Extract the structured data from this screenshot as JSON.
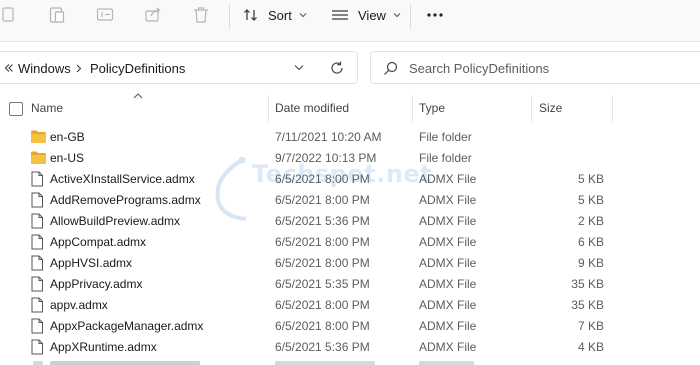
{
  "toolbar": {
    "sort_label": "Sort",
    "view_label": "View",
    "icons": [
      "paste-icon",
      "copy-icon",
      "rename-icon",
      "share-icon",
      "delete-icon",
      "sort-icon",
      "view-icon",
      "more-icon"
    ]
  },
  "address": {
    "breadcrumb": [
      "Windows",
      "PolicyDefinitions"
    ]
  },
  "search": {
    "placeholder": "Search PolicyDefinitions"
  },
  "columns": {
    "name": "Name",
    "date_modified": "Date modified",
    "type": "Type",
    "size": "Size"
  },
  "files": [
    {
      "name": "en-GB",
      "date": "7/11/2021 10:20 AM",
      "type": "File folder",
      "size": "",
      "kind": "folder"
    },
    {
      "name": "en-US",
      "date": "9/7/2022 10:13 PM",
      "type": "File folder",
      "size": "",
      "kind": "folder"
    },
    {
      "name": "ActiveXInstallService.admx",
      "date": "6/5/2021 8:00 PM",
      "type": "ADMX File",
      "size": "5 KB",
      "kind": "file"
    },
    {
      "name": "AddRemovePrograms.admx",
      "date": "6/5/2021 8:00 PM",
      "type": "ADMX File",
      "size": "5 KB",
      "kind": "file"
    },
    {
      "name": "AllowBuildPreview.admx",
      "date": "6/5/2021 5:36 PM",
      "type": "ADMX File",
      "size": "2 KB",
      "kind": "file"
    },
    {
      "name": "AppCompat.admx",
      "date": "6/5/2021 8:00 PM",
      "type": "ADMX File",
      "size": "6 KB",
      "kind": "file"
    },
    {
      "name": "AppHVSI.admx",
      "date": "6/5/2021 8:00 PM",
      "type": "ADMX File",
      "size": "9 KB",
      "kind": "file"
    },
    {
      "name": "AppPrivacy.admx",
      "date": "6/5/2021 5:35 PM",
      "type": "ADMX File",
      "size": "35 KB",
      "kind": "file"
    },
    {
      "name": "appv.admx",
      "date": "6/5/2021 8:00 PM",
      "type": "ADMX File",
      "size": "35 KB",
      "kind": "file"
    },
    {
      "name": "AppxPackageManager.admx",
      "date": "6/5/2021 8:00 PM",
      "type": "ADMX File",
      "size": "7 KB",
      "kind": "file"
    },
    {
      "name": "AppXRuntime.admx",
      "date": "6/5/2021 5:36 PM",
      "type": "ADMX File",
      "size": "4 KB",
      "kind": "file"
    }
  ],
  "watermark": "Techspot.net",
  "colors": {
    "folder": "#f5c143",
    "folder_dark": "#e8a825",
    "toolbar_bg": "#f9f9f9",
    "muted_text": "#5d5d5d"
  }
}
